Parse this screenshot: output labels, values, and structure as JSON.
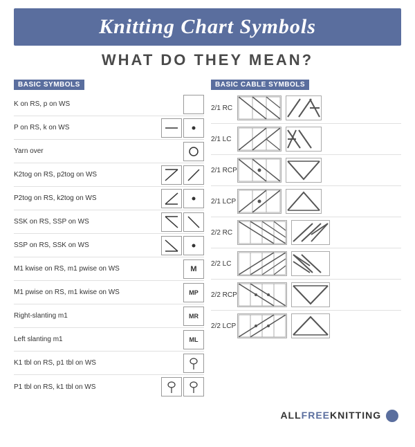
{
  "header": {
    "title": "Knitting Chart Symbols",
    "subtitle": "WHAT DO THEY MEAN?"
  },
  "left_section": {
    "label": "BASIC SYMBOLS",
    "rows": [
      {
        "label": "K on RS, p on WS",
        "symbols": [
          "empty",
          "none"
        ]
      },
      {
        "label": "P on RS, k on WS",
        "symbols": [
          "hline",
          "dot"
        ]
      },
      {
        "label": "Yarn over",
        "symbols": [
          "circle"
        ]
      },
      {
        "label": "K2tog on RS, p2tog on WS",
        "symbols": [
          "diag_r",
          "slash_r"
        ]
      },
      {
        "label": "P2tog on RS, k2tog on WS",
        "symbols": [
          "diag_l_dot",
          "dot"
        ]
      },
      {
        "label": "SSK on RS, SSP on WS",
        "symbols": [
          "diag_l",
          "diag_r2"
        ]
      },
      {
        "label": "SSP on RS, SSK on WS",
        "symbols": [
          "diag_l2",
          "dot2"
        ]
      },
      {
        "label": "M1 kwise on RS, m1 pwise on WS",
        "symbols": [
          "M"
        ]
      },
      {
        "label": "M1 pwise on RS, m1 kwise on WS",
        "symbols": [
          "MP"
        ]
      },
      {
        "label": "Right-slanting m1",
        "symbols": [
          "MR"
        ]
      },
      {
        "label": "Left slanting m1",
        "symbols": [
          "ML"
        ]
      },
      {
        "label": "K1 tbl on RS, p1 tbl on WS",
        "symbols": [
          "loop"
        ]
      },
      {
        "label": "P1 tbl on RS, k1 tbl on WS",
        "symbols": [
          "loop2",
          "loop3"
        ]
      }
    ]
  },
  "right_section": {
    "label": "BASIC CABLE SYMBOLS",
    "rows": [
      {
        "label": "2/1 RC",
        "type": "cable21"
      },
      {
        "label": "2/1 LC",
        "type": "cable21lc"
      },
      {
        "label": "2/1 RCP",
        "type": "cable21rcp"
      },
      {
        "label": "2/1 LCP",
        "type": "cable21lcp"
      },
      {
        "label": "2/2 RC",
        "type": "cable22rc"
      },
      {
        "label": "2/2 LC",
        "type": "cable22lc"
      },
      {
        "label": "2/2 RCP",
        "type": "cable22rcp"
      },
      {
        "label": "2/2 LCP",
        "type": "cable22lcp"
      }
    ]
  },
  "footer": {
    "text": "ALL",
    "highlight": "FREE",
    "text2": "KNITTING"
  }
}
